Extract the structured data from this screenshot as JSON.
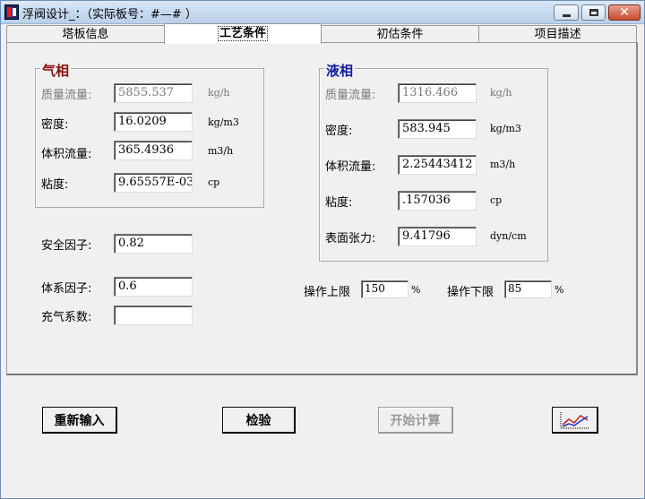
{
  "window": {
    "title": "浮阀设计_：（实际板号：#—# ）"
  },
  "tabs": [
    {
      "label": "塔板信息"
    },
    {
      "label": "工艺条件"
    },
    {
      "label": "初估条件"
    },
    {
      "label": "项目描述"
    }
  ],
  "gas": {
    "title": "气相",
    "mass_flow": {
      "label": "质量流量:",
      "value": "5855.537",
      "unit": "kg/h"
    },
    "density": {
      "label": "密度:",
      "value": "16.0209",
      "unit": "kg/m3"
    },
    "volume_flow": {
      "label": "体积流量:",
      "value": "365.4936",
      "unit": "m3/h"
    },
    "viscosity": {
      "label": "粘度:",
      "value": "9.65557E-03",
      "unit": "cp"
    }
  },
  "liquid": {
    "title": "液相",
    "mass_flow": {
      "label": "质量流量:",
      "value": "1316.466",
      "unit": "kg/h"
    },
    "density": {
      "label": "密度:",
      "value": "583.945",
      "unit": "kg/m3"
    },
    "volume_flow": {
      "label": "体积流量:",
      "value": "2.25443412",
      "unit": "m3/h"
    },
    "viscosity": {
      "label": "粘度:",
      "value": ".157036",
      "unit": "cp"
    },
    "surface_tension": {
      "label": "表面张力:",
      "value": "9.41796",
      "unit": "dyn/cm"
    }
  },
  "safety_factor": {
    "label": "安全因子:",
    "value": "0.82"
  },
  "system_factor": {
    "label": "体系因子:",
    "value": "0.6"
  },
  "aeration_coef": {
    "label": "充气系数:",
    "value": ""
  },
  "op_upper": {
    "label": "操作上限",
    "value": "150",
    "unit": "%"
  },
  "op_lower": {
    "label": "操作下限",
    "value": "85",
    "unit": "%"
  },
  "buttons": {
    "reset": "重新输入",
    "check": "检验",
    "calculate": "开始计算"
  },
  "icons": {
    "chart": "line-chart-icon"
  }
}
